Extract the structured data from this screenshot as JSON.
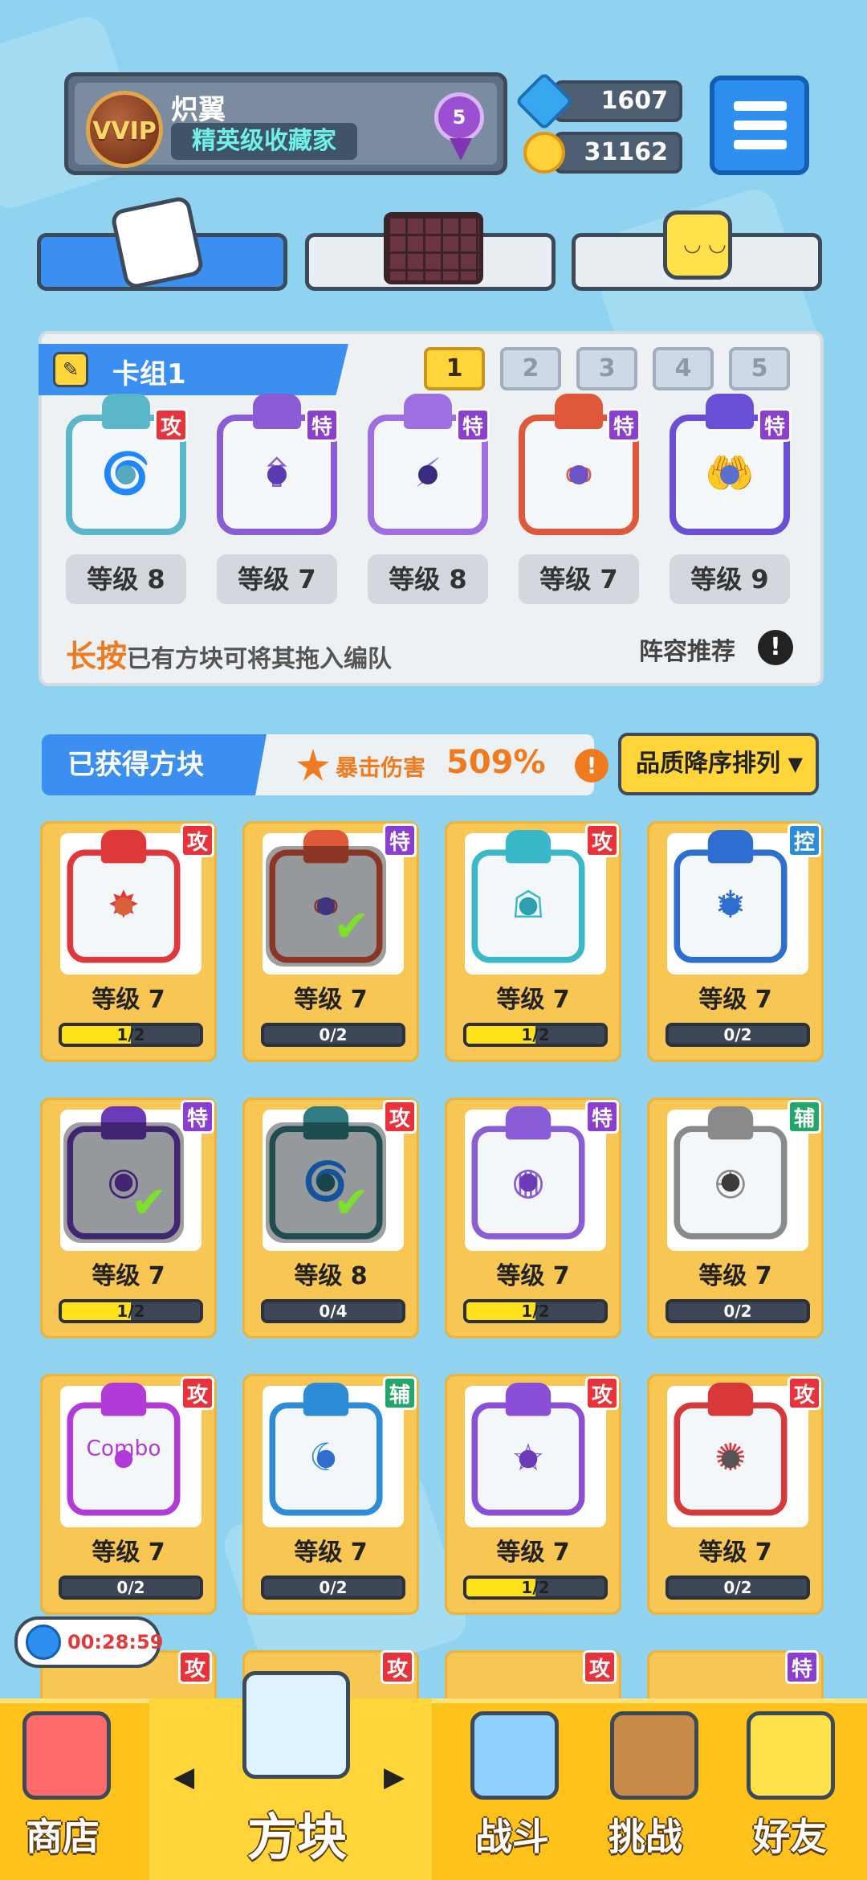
{
  "header": {
    "vip_label": "VVIP",
    "player_name": "炽翼",
    "player_title": "精英级收藏家",
    "medal_level": "5",
    "gems": "1607",
    "coins": "31162"
  },
  "deck": {
    "name": "卡组1",
    "slots": [
      "1",
      "2",
      "3",
      "4",
      "5"
    ],
    "active_slot": "1",
    "cards": [
      {
        "tag": "攻",
        "level": "等级 8",
        "sym": "🌀",
        "ring": "#5ab6c8",
        "dot": "#58a9c0",
        "tagclass": "t-atk"
      },
      {
        "tag": "特",
        "level": "等级 7",
        "sym": "⇧",
        "ring": "#8a5cd6",
        "dot": "#5b3cb0",
        "tagclass": "t-spc"
      },
      {
        "tag": "特",
        "level": "等级 8",
        "sym": "⚡",
        "ring": "#9d6fe0",
        "dot": "#3a2a80",
        "tagclass": "t-spc"
      },
      {
        "tag": "特",
        "level": "等级 7",
        "sym": "∞",
        "ring": "#e0583a",
        "dot": "#6d52c8",
        "tagclass": "t-spc"
      },
      {
        "tag": "特",
        "level": "等级 9",
        "sym": "🤲",
        "ring": "#6a4fd6",
        "dot": "#5b6fd0",
        "tagclass": "t-spc"
      }
    ],
    "hint_em": "长按",
    "hint": "已有方块可将其拖入编队",
    "recommend": "阵容推荐",
    "info_mark": "!"
  },
  "obtained": {
    "title": "已获得方块",
    "crit_label": "暴击伤害",
    "crit_value": "509%",
    "sort_label": "品质降序排列",
    "sort_arrow": "▼",
    "cards": [
      {
        "tag": "攻",
        "level": "等级 7",
        "progress": "1/2",
        "fill": 0.5,
        "ring": "#e0383a",
        "dot": "#d8633a",
        "sym": "✸",
        "tagclass": "t-atk",
        "checked": false
      },
      {
        "tag": "特",
        "level": "等级 7",
        "progress": "0/2",
        "fill": 0,
        "ring": "#e0583a",
        "dot": "#6d52c8",
        "sym": "∞",
        "tagclass": "t-spc",
        "checked": true
      },
      {
        "tag": "攻",
        "level": "等级 7",
        "progress": "1/2",
        "fill": 0.5,
        "ring": "#38b8c8",
        "dot": "#2aa0b0",
        "sym": "☖",
        "tagclass": "t-atk",
        "checked": false
      },
      {
        "tag": "控",
        "level": "等级 7",
        "progress": "0/2",
        "fill": 0,
        "ring": "#2e6ed0",
        "dot": "#2e6ed0",
        "sym": "❄",
        "tagclass": "t-ctl",
        "checked": false
      },
      {
        "tag": "特",
        "level": "等级 7",
        "progress": "1/2",
        "fill": 0.5,
        "ring": "#6a3ab8",
        "dot": "#6a3ab8",
        "sym": "◎",
        "tagclass": "t-spc",
        "checked": true
      },
      {
        "tag": "攻",
        "level": "等级 8",
        "progress": "0/4",
        "fill": 0,
        "ring": "#2f7c84",
        "dot": "#2a6f7a",
        "sym": "🌀",
        "tagclass": "t-atk",
        "checked": true
      },
      {
        "tag": "特",
        "level": "等级 7",
        "progress": "1/2",
        "fill": 0.5,
        "ring": "#8a5cd6",
        "dot": "#6a3ab8",
        "sym": "◍",
        "tagclass": "t-spc",
        "checked": false
      },
      {
        "tag": "辅",
        "level": "等级 7",
        "progress": "0/2",
        "fill": 0,
        "ring": "#8a8a8a",
        "dot": "#3c3c3c",
        "sym": "◴",
        "tagclass": "t-sup",
        "checked": false
      },
      {
        "tag": "攻",
        "level": "等级 7",
        "progress": "0/2",
        "fill": 0,
        "ring": "#b23ad8",
        "dot": "#b23ad8",
        "sym": "Combo",
        "tagclass": "t-atk",
        "checked": false
      },
      {
        "tag": "辅",
        "level": "等级 7",
        "progress": "0/2",
        "fill": 0,
        "ring": "#2e8bd8",
        "dot": "#2e6ed0",
        "sym": "☾",
        "tagclass": "t-sup",
        "checked": false
      },
      {
        "tag": "攻",
        "level": "等级 7",
        "progress": "1/2",
        "fill": 0.5,
        "ring": "#8a4fd6",
        "dot": "#6a3ab8",
        "sym": "☆",
        "tagclass": "t-atk",
        "checked": false
      },
      {
        "tag": "攻",
        "level": "等级 7",
        "progress": "0/2",
        "fill": 0,
        "ring": "#d8383a",
        "dot": "#555",
        "sym": "✺",
        "tagclass": "t-atk",
        "checked": false
      }
    ],
    "peek_tags": [
      {
        "tag": "攻",
        "tagclass": "t-atk"
      },
      {
        "tag": "攻",
        "tagclass": "t-atk"
      },
      {
        "tag": "攻",
        "tagclass": "t-atk"
      },
      {
        "tag": "特",
        "tagclass": "t-spc"
      }
    ]
  },
  "timer": "00:28:59",
  "nav": {
    "shop": "商店",
    "blocks": "方块",
    "battle": "战斗",
    "challenge": "挑战",
    "friends": "好友",
    "arrow_left": "◀",
    "arrow_right": "▶"
  }
}
